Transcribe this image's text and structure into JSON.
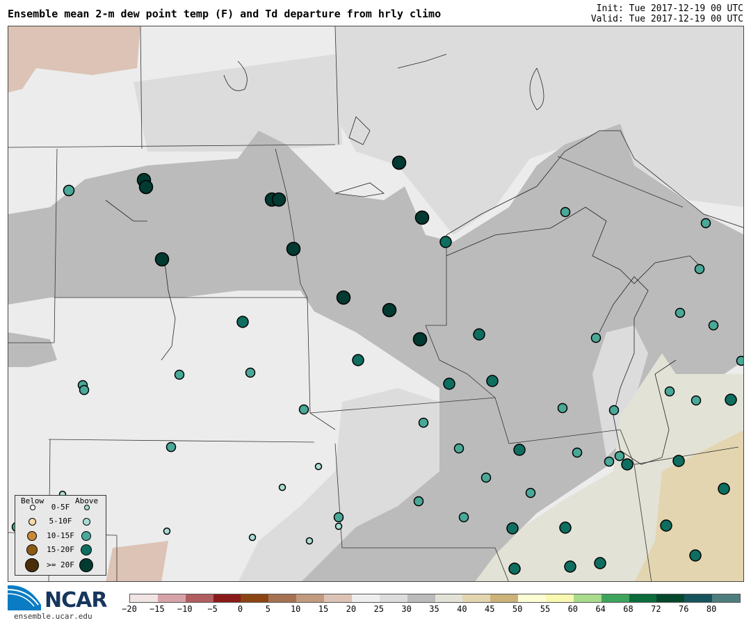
{
  "header": {
    "title": "Ensemble mean 2-m dew point temp (F) and Td departure from hrly climo",
    "init": "Init: Tue 2017-12-19 00 UTC",
    "valid": "Valid: Tue 2017-12-19 00 UTC"
  },
  "colors": {
    "lt20": "#f0e4e4",
    "m20_15": "#d6a4a8",
    "m15_10": "#b15e60",
    "m10_5": "#8b1a1a",
    "m5_0": "#8b4513",
    "c0_5": "#a67352",
    "c5_10": "#c29a80",
    "c10_15": "#dcc3b5",
    "c15_20": "#eeeeee",
    "c20_25": "#ececec",
    "c25_30": "#dcdcdc",
    "c30_35": "#bbbbbb",
    "c35_40": "#e2e2d6",
    "c40_45": "#e3d5b0",
    "c45_50": "#cbb37a",
    "c50_55": "#fdfdd6",
    "c55_60": "#f8f8b0",
    "c60_64": "#a8dc8c",
    "c64_68": "#3da35d",
    "c68_72": "#0b6b3a",
    "c72_76": "#04472d",
    "c76_80": "#17535a",
    "c80p": "#4e7d7d",
    "dot_above_small": "#a8dcd2",
    "dot_above_med": "#4aa898",
    "dot_above_large": "#0e6e60",
    "dot_above_xl": "#013a30",
    "dot_below_small": "#ffffff",
    "dot_below_med": "#f5d9a8",
    "dot_below_large": "#c8883a",
    "dot_below_xl": "#8b5a14",
    "dot_below_xxl": "#4a2e0a"
  },
  "legend": {
    "below": "Below",
    "above": "Above",
    "rows": [
      "0-5F",
      "5-10F",
      "10-15F",
      "15-20F",
      ">= 20F"
    ]
  },
  "logo": {
    "text": "NCAR",
    "url": "ensemble.ucar.edu"
  },
  "colorbar": {
    "segments": [
      "#f0e4e4",
      "#d6a4a8",
      "#b15e60",
      "#8b1a1a",
      "#8b4513",
      "#a67352",
      "#c29a80",
      "#dcc3b5",
      "#eeeeee",
      "#dcdcdc",
      "#bbbbbb",
      "#e2e2d6",
      "#e3d5b0",
      "#cbb37a",
      "#fdfdd6",
      "#f8f8b0",
      "#a8dc8c",
      "#3da35d",
      "#0b6b3a",
      "#04472d",
      "#17535a",
      "#4e7d7d"
    ],
    "labels": [
      "-20",
      "-15",
      "-10",
      "-5",
      "0",
      "5",
      "10",
      "15",
      "20",
      "25",
      "30",
      "35",
      "40",
      "45",
      "50",
      "55",
      "60",
      "64",
      "68",
      "72",
      "76",
      "80"
    ]
  }
}
